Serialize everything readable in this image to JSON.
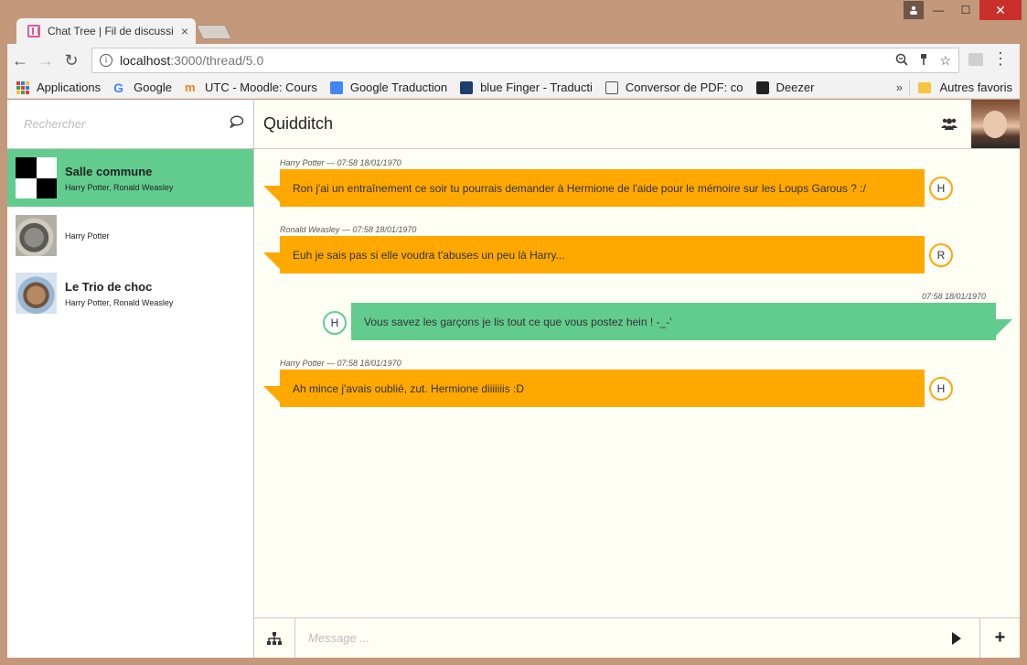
{
  "browser": {
    "tab_title": "Chat Tree | Fil de discussi",
    "tab_close": "×",
    "url_host": "localhost",
    "url_path": ":3000/thread/5.0",
    "bookmarks": [
      {
        "label": "Applications"
      },
      {
        "label": "Google"
      },
      {
        "label": "UTC - Moodle: Cours"
      },
      {
        "label": "Google Traduction"
      },
      {
        "label": "blue Finger - Traducti"
      },
      {
        "label": "Conversor de PDF: co"
      },
      {
        "label": "Deezer"
      }
    ],
    "more": "»",
    "other_bookmarks": "Autres favoris"
  },
  "sidebar": {
    "search_placeholder": "Rechercher",
    "conversations": [
      {
        "name": "Salle commune",
        "members": "Harry Potter, Ronald Weasley",
        "active": true
      },
      {
        "name": "",
        "members": "Harry Potter",
        "active": false
      },
      {
        "name": "Le Trio de choc",
        "members": "Harry Potter, Ronald Weasley",
        "active": false
      }
    ]
  },
  "thread": {
    "title": "Quidditch",
    "messages": [
      {
        "meta": "Harry Potter — 07:58  18/01/1970",
        "text": "Ron j'ai un entraînement ce soir tu pourrais demander à Hermione de l'aide pour le mémoire sur les Loups Garous ? :/",
        "initial": "H",
        "side": "left"
      },
      {
        "meta": "Ronald Weasley — 07:58  18/01/1970",
        "text": "Euh je sais pas si elle voudra t'abuses un peu là Harry...",
        "initial": "R",
        "side": "left"
      },
      {
        "meta": "07:58  18/01/1970",
        "text": "Vous savez les garçons je lis tout ce que vous postez hein ! -_-'",
        "initial": "H",
        "side": "right"
      },
      {
        "meta": "Harry Potter — 07:58  18/01/1970",
        "text": "Ah mince j'avais oublié, zut. Hermione diiiiiiis :D",
        "initial": "H",
        "side": "left"
      }
    ]
  },
  "composer": {
    "placeholder": "Message ...",
    "plus": "+"
  },
  "colors": {
    "green": "#62cc8e",
    "orange": "#ffa800"
  }
}
